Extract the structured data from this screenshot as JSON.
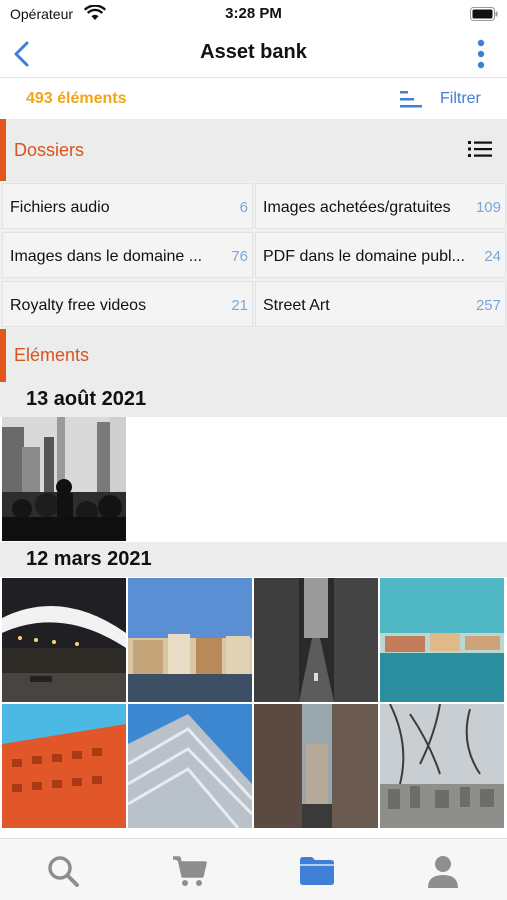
{
  "status_bar": {
    "carrier": "Opérateur",
    "time": "3:28 PM"
  },
  "nav": {
    "title": "Asset bank",
    "back_icon": "chevron-left-icon",
    "more_icon": "more-vertical-icon"
  },
  "toolbar": {
    "count": "493 éléments",
    "filter_label": "Filtrer",
    "sort_icon": "sort-lines-icon"
  },
  "colors": {
    "accent": "#e0561c",
    "count": "#f2a516",
    "link": "#3f7fd6",
    "folder_count": "#7aa7d6",
    "tab_active": "#3f7fd6",
    "tab_inactive": "#8e8e8e"
  },
  "folders_section": {
    "title": "Dossiers",
    "view_icon": "list-view-icon"
  },
  "folders": [
    {
      "name": "Fichiers audio",
      "count": "6"
    },
    {
      "name": "Images achetées/gratuites",
      "count": "109"
    },
    {
      "name": "Images dans le domaine ...",
      "count": "76"
    },
    {
      "name": "PDF dans le domaine publ...",
      "count": "24"
    },
    {
      "name": "Royalty free videos",
      "count": "21"
    },
    {
      "name": "Street Art",
      "count": "257"
    }
  ],
  "elements_section": {
    "title": "Eléments"
  },
  "groups": [
    {
      "date": "13 août 2021",
      "photos": [
        "bw-city-crowd"
      ]
    },
    {
      "date": "12 mars 2021",
      "photos": [
        "bridge-night",
        "river-buildings",
        "narrow-street-bw",
        "lake-waterfront",
        "orange-facade",
        "glass-building",
        "old-alley",
        "city-view-tree"
      ]
    }
  ],
  "tab_bar": {
    "tabs": [
      "search-icon",
      "cart-icon",
      "folder-icon",
      "user-icon"
    ],
    "active": "folder-icon"
  }
}
